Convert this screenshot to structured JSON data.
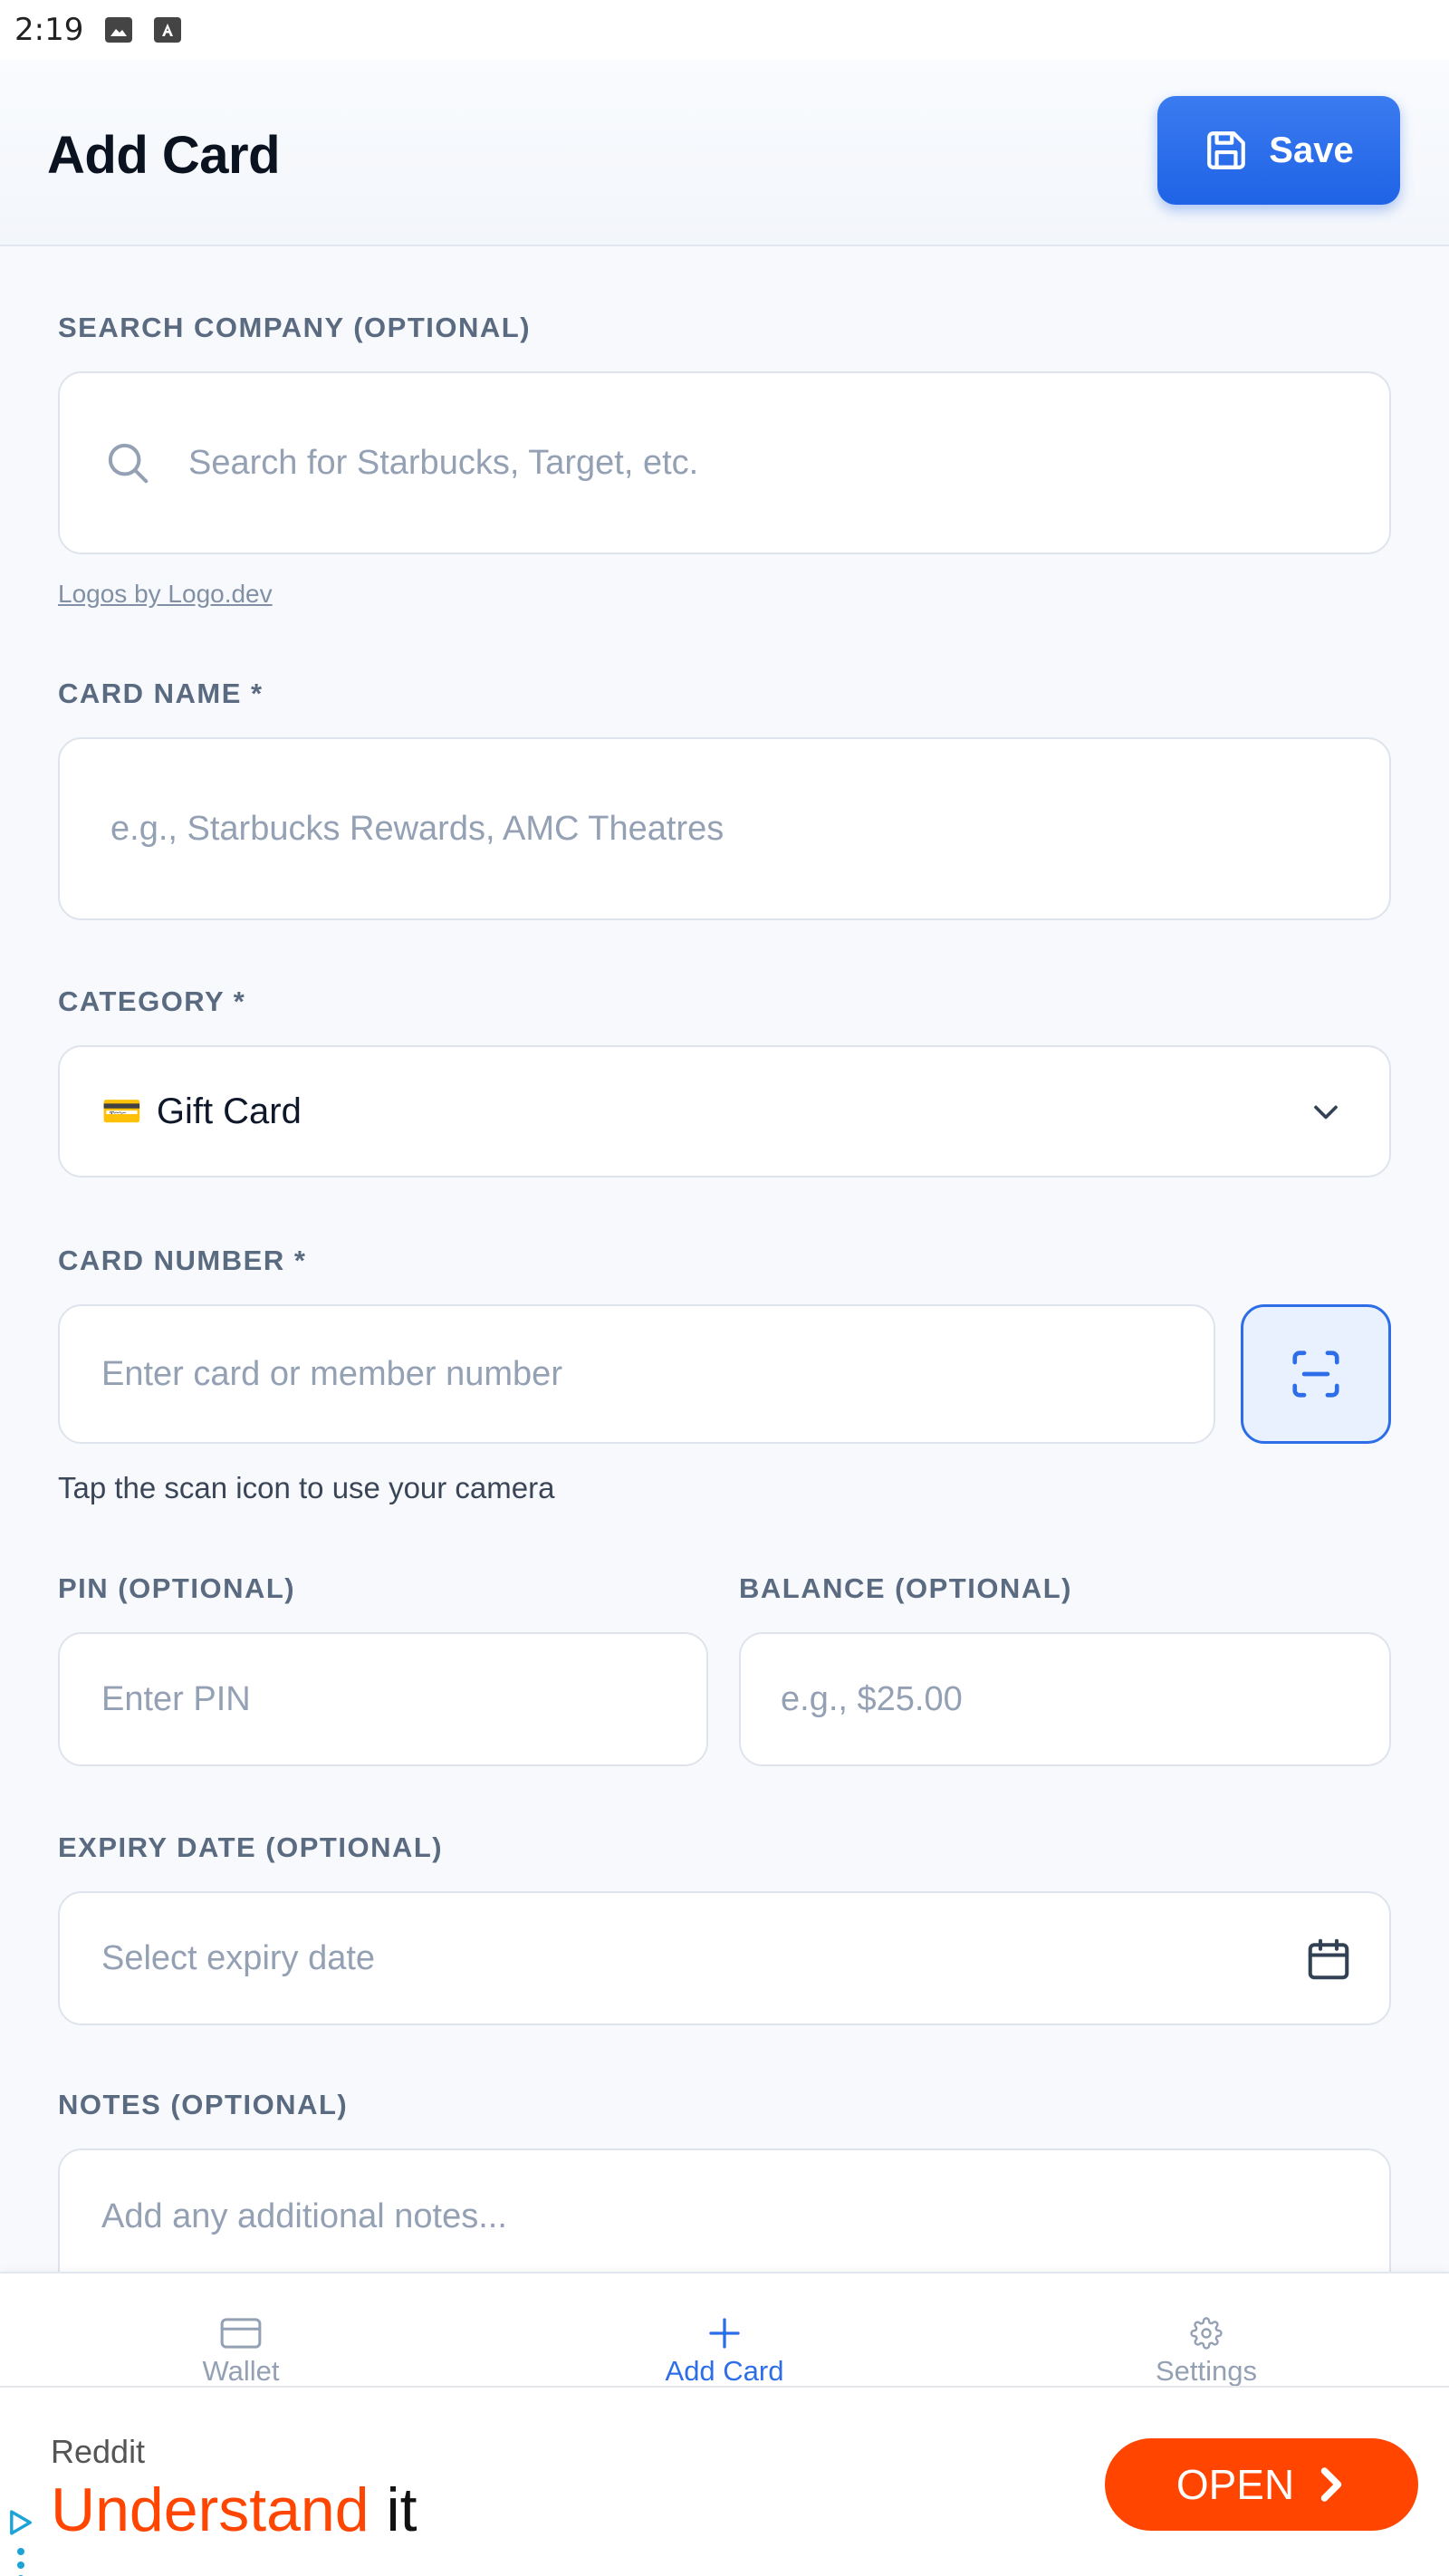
{
  "status_bar": {
    "time": "2:19"
  },
  "header": {
    "title": "Add Card",
    "save_label": "Save"
  },
  "form": {
    "search_company": {
      "label": "SEARCH COMPANY (OPTIONAL)",
      "placeholder": "Search for Starbucks, Target, etc."
    },
    "logo_credit": "Logos by Logo.dev",
    "card_name": {
      "label": "CARD NAME *",
      "placeholder": "e.g., Starbucks Rewards, AMC Theatres"
    },
    "category": {
      "label": "CATEGORY *",
      "selected_icon": "💳",
      "selected": "Gift Card"
    },
    "card_number": {
      "label": "CARD NUMBER *",
      "placeholder": "Enter card or member number",
      "helper": "Tap the scan icon to use your camera"
    },
    "pin": {
      "label": "PIN (OPTIONAL)",
      "placeholder": "Enter PIN"
    },
    "balance": {
      "label": "BALANCE (OPTIONAL)",
      "placeholder": "e.g., $25.00"
    },
    "expiry_date": {
      "label": "EXPIRY DATE (OPTIONAL)",
      "placeholder": "Select expiry date"
    },
    "notes": {
      "label": "NOTES (OPTIONAL)",
      "placeholder": "Add any additional notes..."
    }
  },
  "bottom_nav": {
    "items": [
      {
        "label": "Wallet",
        "icon": "credit-card-icon",
        "active": false
      },
      {
        "label": "Add Card",
        "icon": "plus-icon",
        "active": true
      },
      {
        "label": "Settings",
        "icon": "gear-icon",
        "active": false
      }
    ]
  },
  "ad": {
    "source": "Reddit",
    "headline_highlight": "Understand",
    "headline_rest": "it",
    "cta": "OPEN"
  },
  "colors": {
    "primary": "#2d6ee8",
    "ad_accent": "#ff4500",
    "label_gray": "#5a6a80",
    "placeholder_gray": "#94a0b3"
  }
}
